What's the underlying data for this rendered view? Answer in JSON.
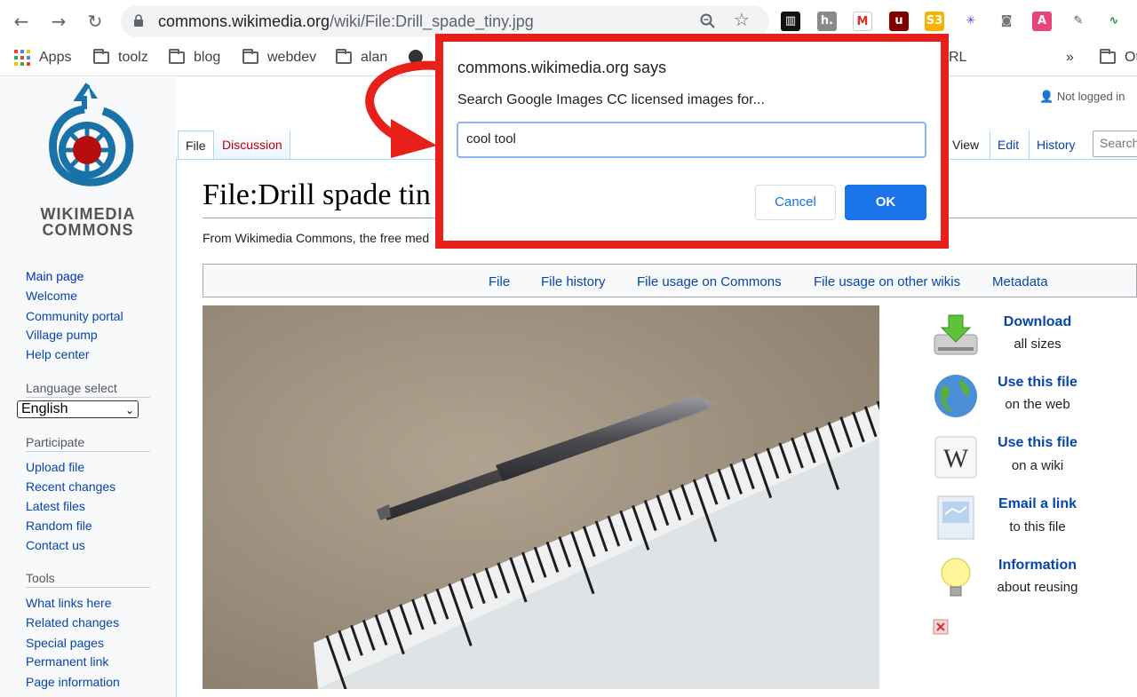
{
  "browser": {
    "url_host": "commons.wikimedia.org",
    "url_path": "/wiki/File:Drill_spade_tiny.jpg",
    "bookmarks": [
      "Apps",
      "toolz",
      "blog",
      "webdev",
      "alan"
    ],
    "bookmark_right_fragment": "RL",
    "overflow": "»",
    "other_fragment": "Ot"
  },
  "account": {
    "not_logged_in": "Not logged in"
  },
  "logo": {
    "line1": "WIKIMEDIA",
    "line2": "COMMONS"
  },
  "sidebar": {
    "nav": [
      "Main page",
      "Welcome",
      "Community portal",
      "Village pump",
      "Help center"
    ],
    "language_heading": "Language select",
    "language_value": "English",
    "participate_heading": "Participate",
    "participate": [
      "Upload file",
      "Recent changes",
      "Latest files",
      "Random file",
      "Contact us"
    ],
    "tools_heading": "Tools",
    "tools": [
      "What links here",
      "Related changes",
      "Special pages",
      "Permanent link",
      "Page information"
    ]
  },
  "tabs": {
    "file": "File",
    "discussion": "Discussion",
    "view": "View",
    "edit": "Edit",
    "history": "History",
    "search_placeholder": "Search"
  },
  "page": {
    "title": "File:Drill spade tin",
    "from": "From Wikimedia Commons, the free med"
  },
  "filetoc": [
    "File",
    "File history",
    "File usage on Commons",
    "File usage on other wikis",
    "Metadata"
  ],
  "actions": [
    {
      "title": "Download",
      "sub": "all sizes",
      "icon": "download-icon"
    },
    {
      "title": "Use this file",
      "sub": "on the web",
      "icon": "globe-icon"
    },
    {
      "title": "Use this file",
      "sub": "on a wiki",
      "icon": "wikipedia-icon"
    },
    {
      "title": "Email a link",
      "sub": "to this file",
      "icon": "email-icon"
    },
    {
      "title": "Information",
      "sub": "about reusing",
      "icon": "lightbulb-icon"
    }
  ],
  "dialog": {
    "title": "commons.wikimedia.org says",
    "message": "Search Google Images CC licensed images for...",
    "input_value": "cool tool",
    "cancel": "Cancel",
    "ok": "OK"
  },
  "colors": {
    "link": "#0645ad",
    "highlight_frame": "#e8201a",
    "ok_button": "#1a73e8"
  }
}
